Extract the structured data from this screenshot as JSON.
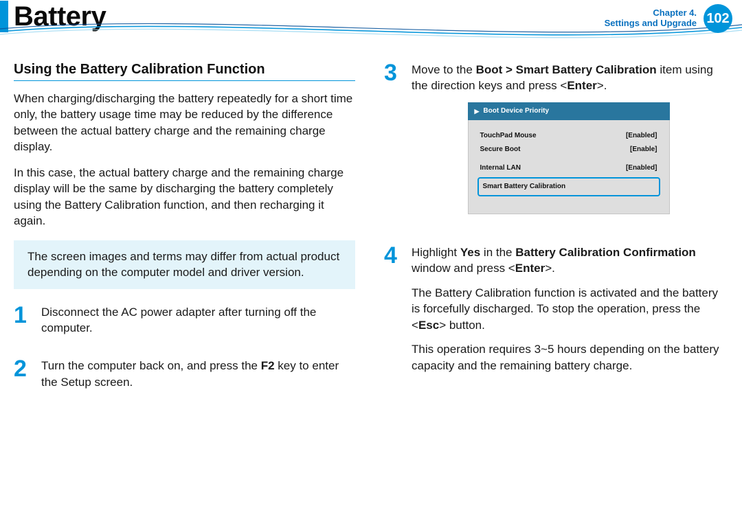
{
  "header": {
    "title": "Battery",
    "chapter_line": "Chapter 4.",
    "section_line": "Settings and Upgrade",
    "page_number": "102"
  },
  "left": {
    "heading": "Using the Battery Calibration Function",
    "para1": "When charging/discharging the battery repeatedly for a short time only, the battery usage time may be reduced by the difference between the actual battery charge and the remaining charge display.",
    "para2": "In this case, the actual battery charge and the remaining charge display will be the same by discharging the battery completely using the Battery Calibration function, and then recharging it again.",
    "note": "The screen images and terms may differ from actual product depending on the computer model and driver version.",
    "step1_num": "1",
    "step1_text": "Disconnect the AC power adapter after turning off the computer.",
    "step2_num": "2",
    "step2_pre": "Turn the computer back on, and press the ",
    "step2_key": "F2",
    "step2_post": " key to enter the Setup screen."
  },
  "right": {
    "step3_num": "3",
    "step3_pre": "Move to the ",
    "step3_path": "Boot > Smart Battery Calibration",
    "step3_mid": " item using the direction keys and press <",
    "step3_key": "Enter",
    "step3_post": ">.",
    "bios": {
      "header": "Boot Device Priority",
      "rows": [
        {
          "label": "TouchPad Mouse",
          "value": "[Enabled]"
        },
        {
          "label": "Secure Boot",
          "value": "[Enable]"
        }
      ],
      "row_lan": {
        "label": "Internal LAN",
        "value": "[Enabled]"
      },
      "selected": "Smart Battery Calibration"
    },
    "step4_num": "4",
    "step4_l1_a": "Highlight ",
    "step4_l1_yes": "Yes",
    "step4_l1_b": " in the ",
    "step4_l1_win": "Battery Calibration Confirmation",
    "step4_l1_c": " window and press <",
    "step4_l1_key": "Enter",
    "step4_l1_d": ">.",
    "step4_p2_a": "The Battery Calibration function is activated and the battery is forcefully discharged. To stop the operation, press the <",
    "step4_p2_key": "Esc",
    "step4_p2_b": "> button.",
    "step4_p3": "This operation requires 3~5 hours depending on the battery capacity and the remaining battery charge."
  }
}
